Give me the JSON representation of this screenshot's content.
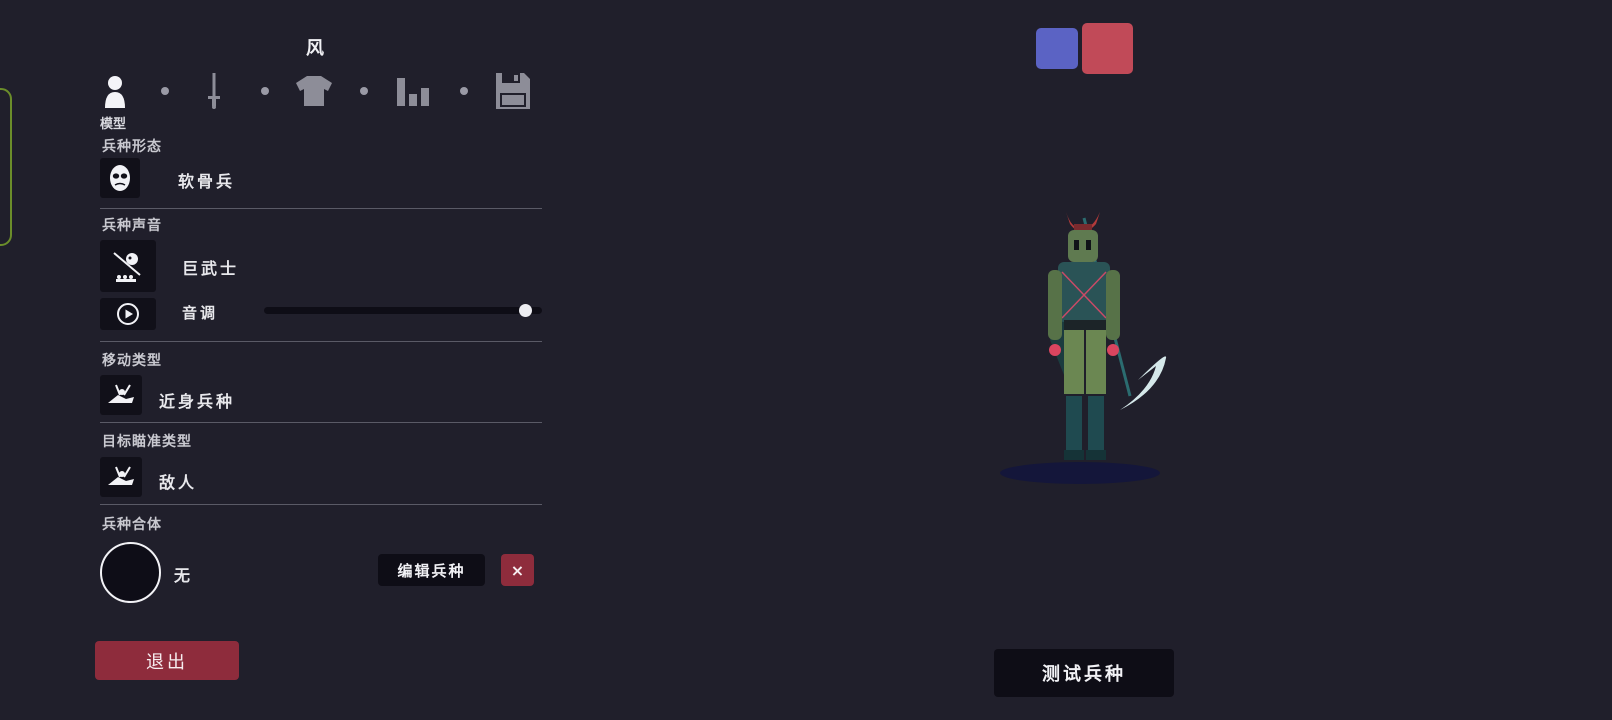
{
  "editor": {
    "title": "风",
    "current_step_label": "模型",
    "steps": [
      {
        "icon": "person-icon",
        "active": true
      },
      {
        "icon": "sword-icon",
        "active": false
      },
      {
        "icon": "shirt-icon",
        "active": false
      },
      {
        "icon": "bar-chart-icon",
        "active": false
      },
      {
        "icon": "save-icon",
        "active": false
      }
    ]
  },
  "sections": {
    "unit_form": {
      "title": "兵种形态",
      "value": "软骨兵",
      "icon": "mask-icon"
    },
    "unit_voice": {
      "title": "兵种声音",
      "value": "巨武士",
      "icon": "samurai-voice-icon",
      "pitch_label": "音调",
      "pitch_level": 0.94,
      "play_icon": "play-icon"
    },
    "movement_type": {
      "title": "移动类型",
      "value": "近身兵种",
      "icon": "melee-icon"
    },
    "target_type": {
      "title": "目标瞄准类型",
      "value": "敌人",
      "icon": "target-enemy-icon"
    },
    "unit_combine": {
      "title": "兵种合体",
      "value": "无",
      "edit_label": "编辑兵种",
      "remove_label": "×"
    }
  },
  "buttons": {
    "exit_label": "退出",
    "test_label": "测试兵种"
  },
  "team_colors": {
    "blue": "#5b63c4",
    "red": "#c14a58",
    "selected": "red"
  },
  "colors": {
    "background": "#201f2b",
    "panel_dark": "#0e0d16",
    "accent_red": "#8e2c3c"
  }
}
